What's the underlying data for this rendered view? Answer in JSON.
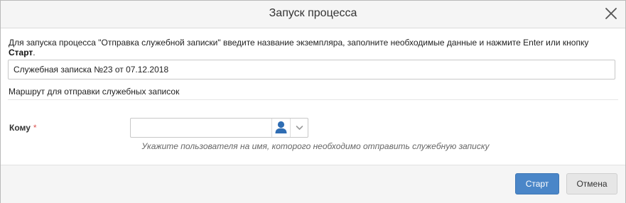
{
  "dialog": {
    "title": "Запуск процесса",
    "close_icon": "close-icon"
  },
  "intro": {
    "text": "Для запуска процесса \"Отправка служебной записки\" введите название экземпляра, заполните необходимые данные и нажмите Enter или кнопку ",
    "bold": "Старт",
    "end": "."
  },
  "instance_name": {
    "value": "Служебная записка №23 от 07.12.2018"
  },
  "route": {
    "label": "Маршрут для отправки служебных записок"
  },
  "recipient": {
    "label": "Кому",
    "required_mark": "*",
    "value": "",
    "user_icon": "user-icon",
    "dropdown_icon": "chevron-down-icon",
    "hint": "Укажите пользователя на имя, которого необходимо отправить служебную записку"
  },
  "footer": {
    "start_label": "Старт",
    "cancel_label": "Отмена"
  },
  "colors": {
    "primary_button": "#4a86c8",
    "user_icon": "#2f6db3",
    "required": "#d9534f"
  }
}
